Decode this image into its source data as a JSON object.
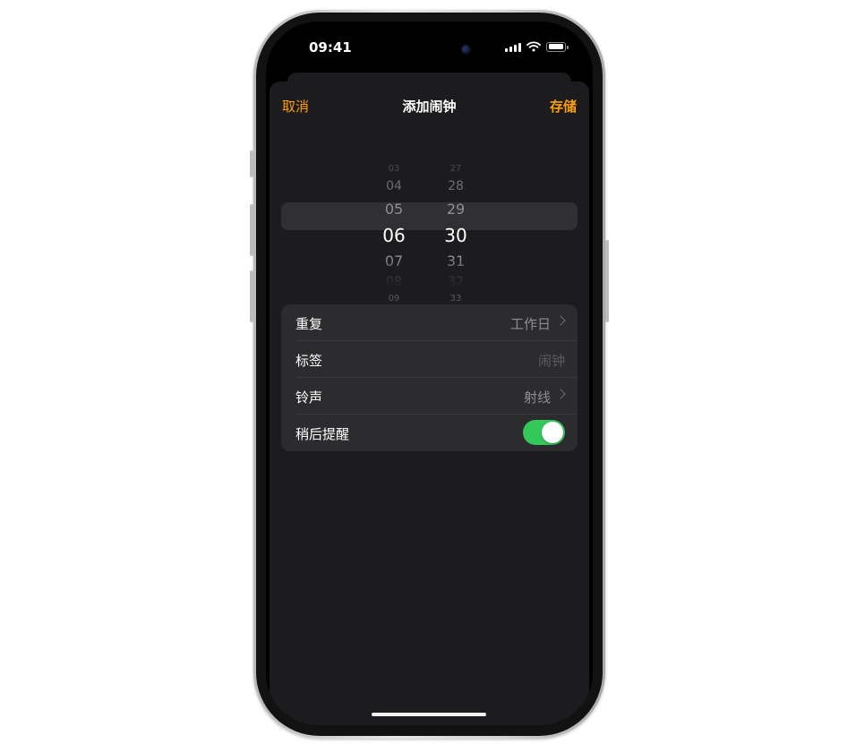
{
  "status_bar": {
    "time": "09:41"
  },
  "nav": {
    "cancel": "取消",
    "title": "添加闹钟",
    "save": "存储"
  },
  "picker": {
    "hours": [
      "03",
      "04",
      "05",
      "06",
      "07",
      "08",
      "09"
    ],
    "minutes": [
      "27",
      "28",
      "29",
      "30",
      "31",
      "32",
      "33"
    ],
    "selected_hour": "06",
    "selected_minute": "30"
  },
  "settings": {
    "repeat": {
      "label": "重复",
      "value": "工作日"
    },
    "label": {
      "label": "标签",
      "placeholder": "闹钟"
    },
    "sound": {
      "label": "铃声",
      "value": "射线"
    },
    "snooze": {
      "label": "稍后提醒",
      "enabled": true
    }
  },
  "colors": {
    "accent": "#ff9f0a",
    "toggle_on": "#34c759",
    "sheet_bg": "#1c1c1e",
    "cell_bg": "#2c2c2e"
  },
  "icons": [
    "signal-icon",
    "wifi-icon",
    "battery-icon",
    "chevron-right-icon"
  ]
}
